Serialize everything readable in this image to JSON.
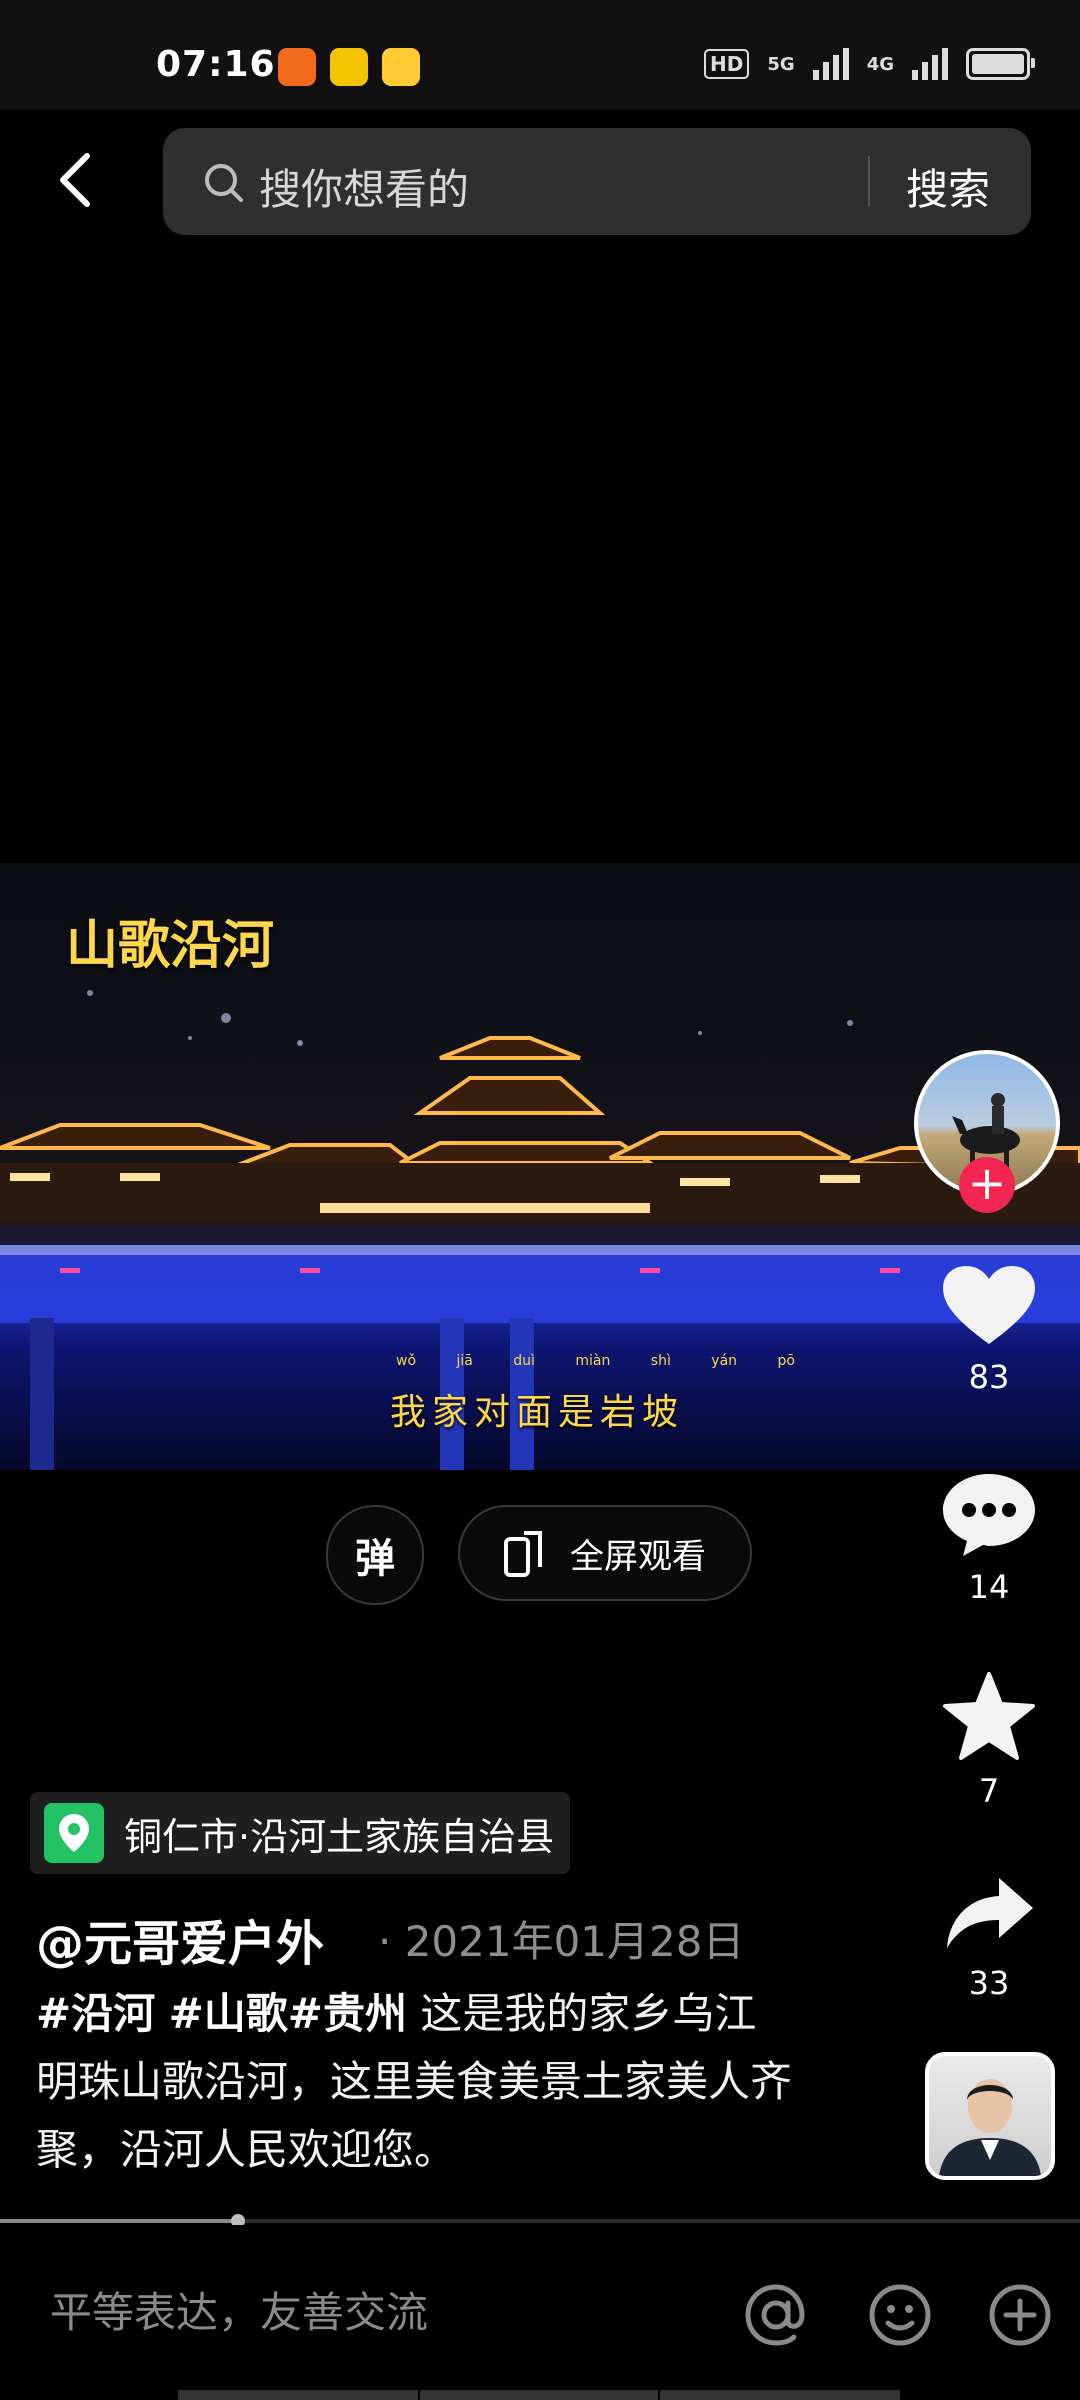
{
  "status_bar": {
    "time": "07:16",
    "network_badges": [
      "HD",
      "5G",
      "4G"
    ],
    "app_icons": [
      "fox-app-icon",
      "heart-app-icon",
      "weibo-icon"
    ]
  },
  "search": {
    "placeholder": "搜你想看的",
    "button_label": "搜索"
  },
  "video": {
    "overlay_title": "山歌沿河",
    "subtitle": "我家对面是岩坡",
    "subtitle_pinyin": "wǒ jiā duì miàn shì yán pō",
    "progress_fraction": 0.22
  },
  "controls": {
    "danmu_label": "弹",
    "fullscreen_label": "全屏观看"
  },
  "actions": {
    "likes": "83",
    "comments": "14",
    "favorites": "7",
    "shares": "33"
  },
  "post": {
    "location": "铜仁市·沿河土家族自治县",
    "author": "@元哥爱户外",
    "date": "· 2021年01月28日",
    "tags": [
      "#沿河",
      "#山歌",
      "#贵州"
    ],
    "description_line1": "这是我的家乡乌江",
    "description_rest": "明珠山歌沿河，这里美食美景土家美人齐聚，沿河人民欢迎您。"
  },
  "comment_bar": {
    "placeholder": "平等表达，友善交流"
  },
  "colors": {
    "accent_red": "#f1254f",
    "location_green": "#23c264",
    "subtitle_yellow": "#ffd84a"
  }
}
